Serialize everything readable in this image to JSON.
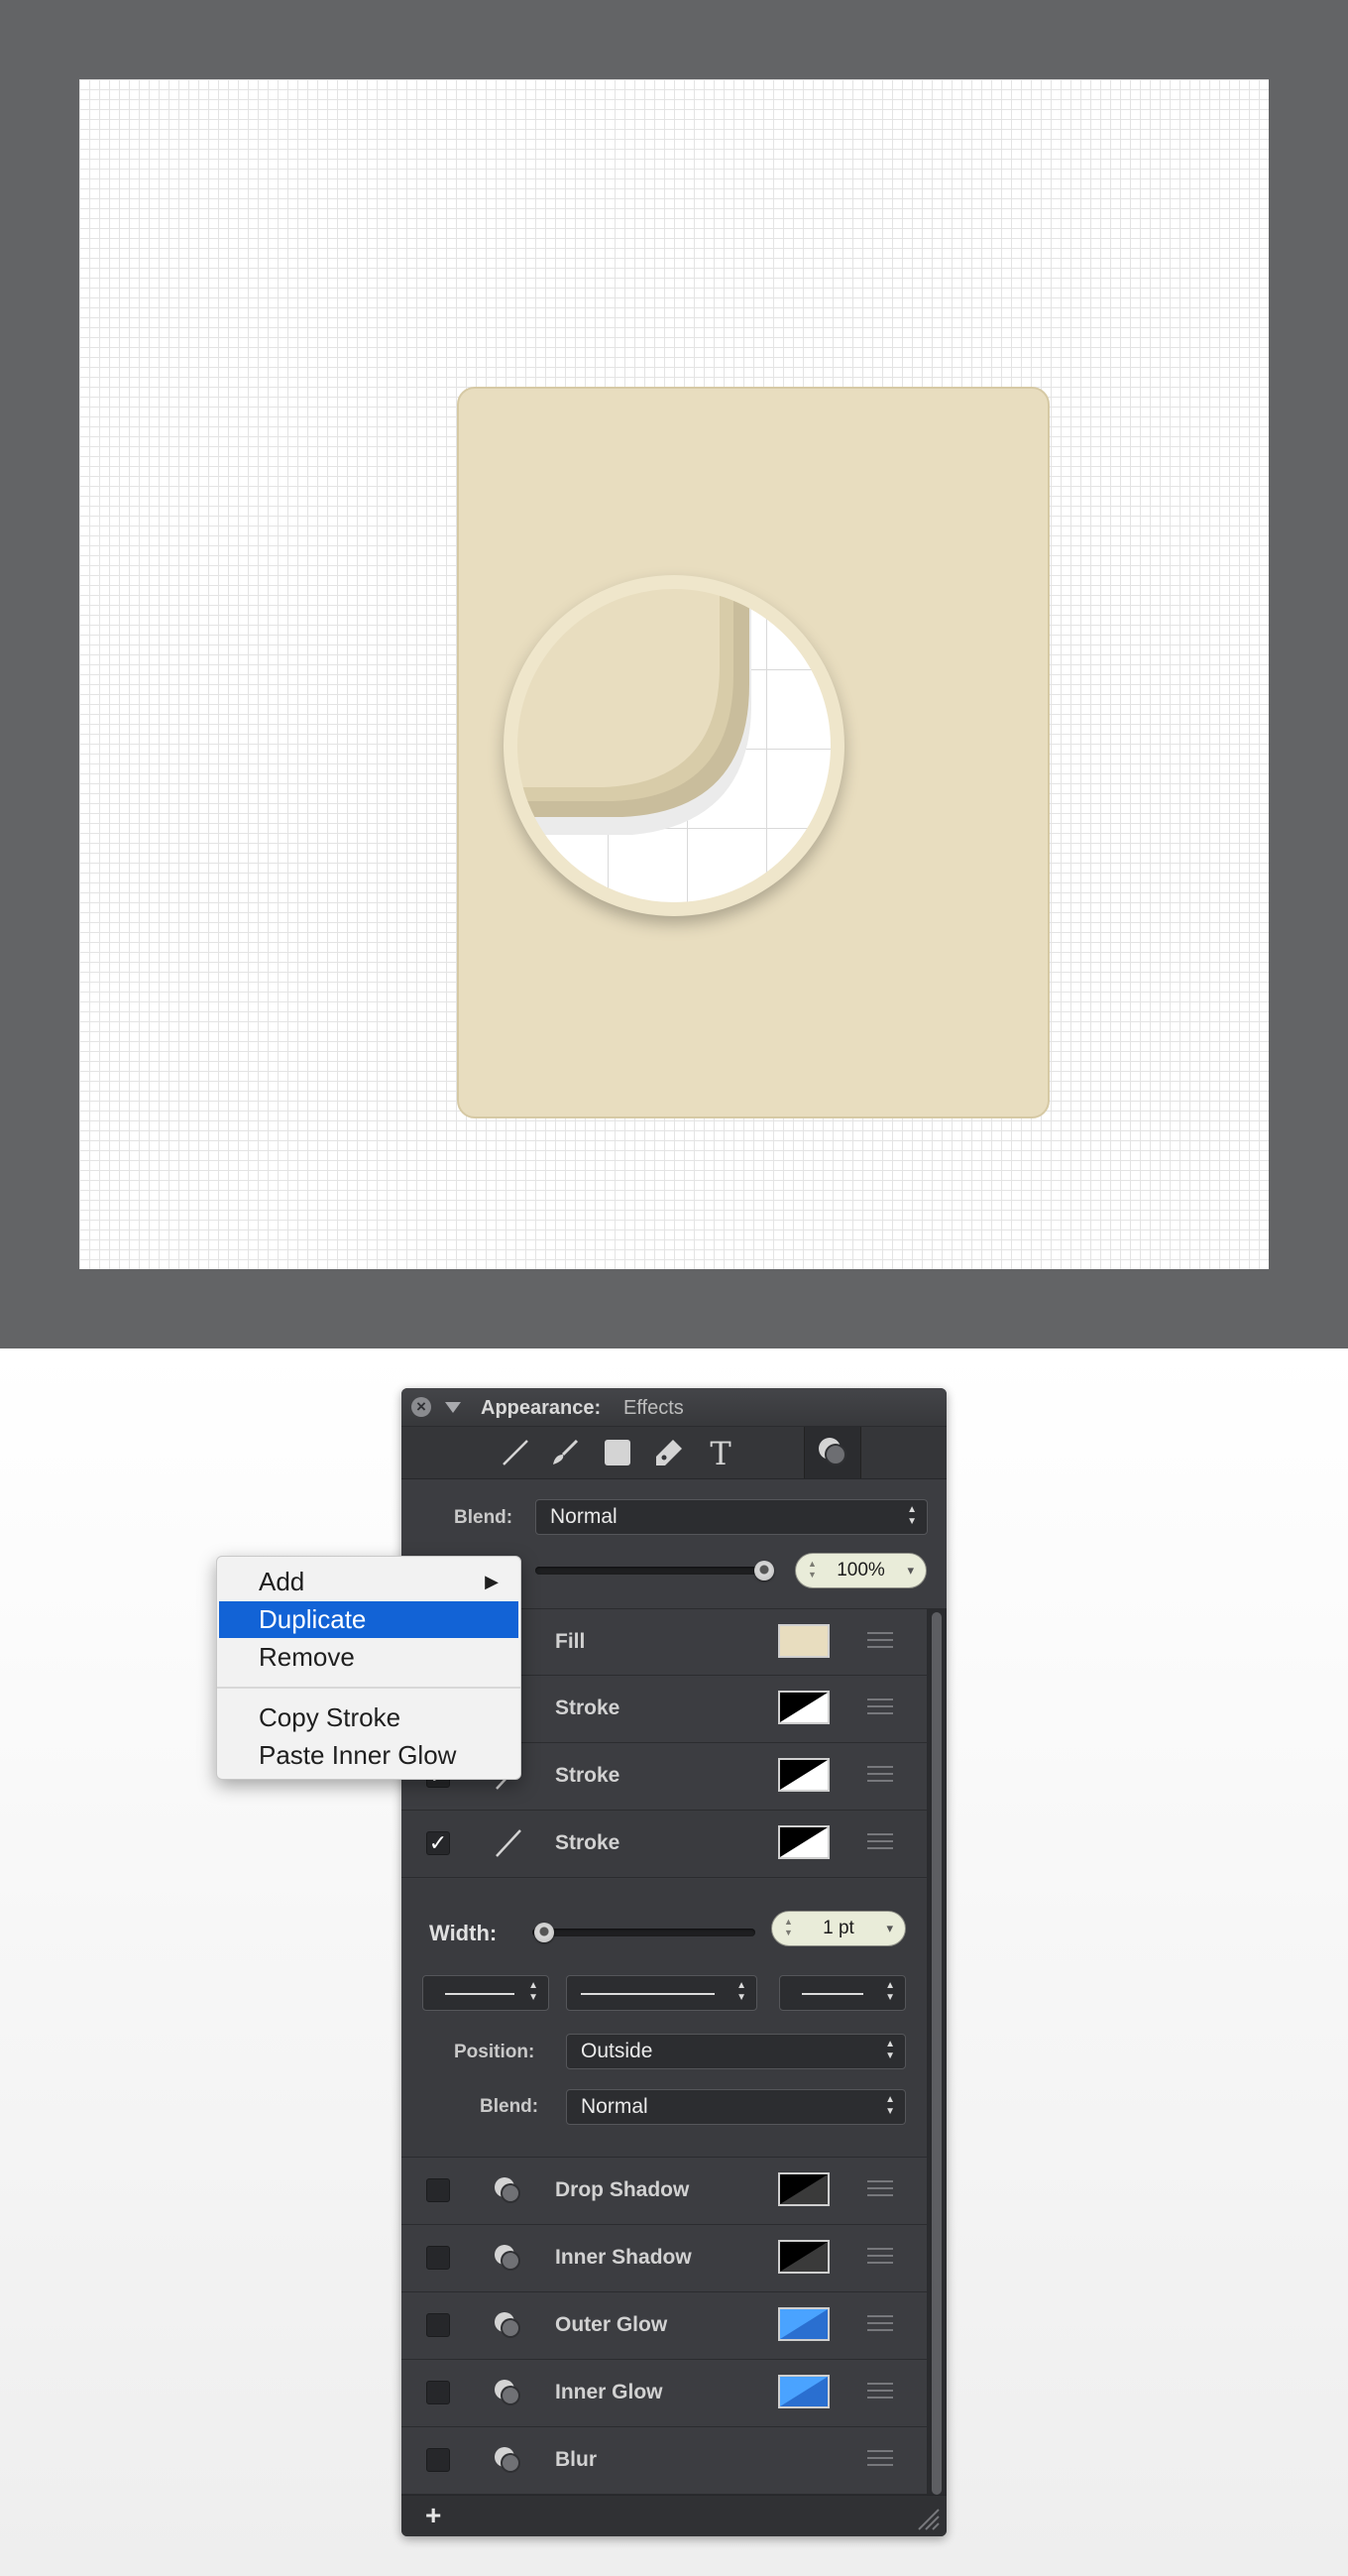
{
  "panel": {
    "title": "Appearance:",
    "subtitle": "Effects",
    "toolbar": [
      "line-tool",
      "brush-tool",
      "rectangle-tool",
      "pen-tool",
      "text-tool",
      "effects-tool"
    ],
    "blend_label": "Blend:",
    "blend_value": "Normal",
    "opacity_value": "100%",
    "layers": [
      {
        "name": "Fill",
        "checked": true,
        "swatch": "#e8ddbf"
      },
      {
        "name": "Stroke",
        "checked": true
      },
      {
        "name": "Stroke",
        "checked": true
      },
      {
        "name": "Stroke",
        "checked": true
      }
    ],
    "stroke_settings": {
      "width_label": "Width:",
      "width_value": "1 pt",
      "position_label": "Position:",
      "position_value": "Outside",
      "blend_label": "Blend:",
      "blend_value": "Normal"
    },
    "effects": [
      {
        "name": "Drop Shadow",
        "swatch": "#000000"
      },
      {
        "name": "Inner Shadow",
        "swatch": "#000000"
      },
      {
        "name": "Outer Glow",
        "swatch": "#3a8ef0"
      },
      {
        "name": "Inner Glow",
        "swatch": "#3a8ef0"
      },
      {
        "name": "Blur"
      }
    ],
    "add_label": "+"
  },
  "context_menu": {
    "items": [
      "Add",
      "Duplicate",
      "Remove",
      "Copy Stroke",
      "Paste Inner Glow"
    ],
    "selected": "Duplicate"
  },
  "colors": {
    "canvas_frame": "#636466",
    "card_fill": "#e8ddbf",
    "selection_blue": "#1263d6"
  }
}
